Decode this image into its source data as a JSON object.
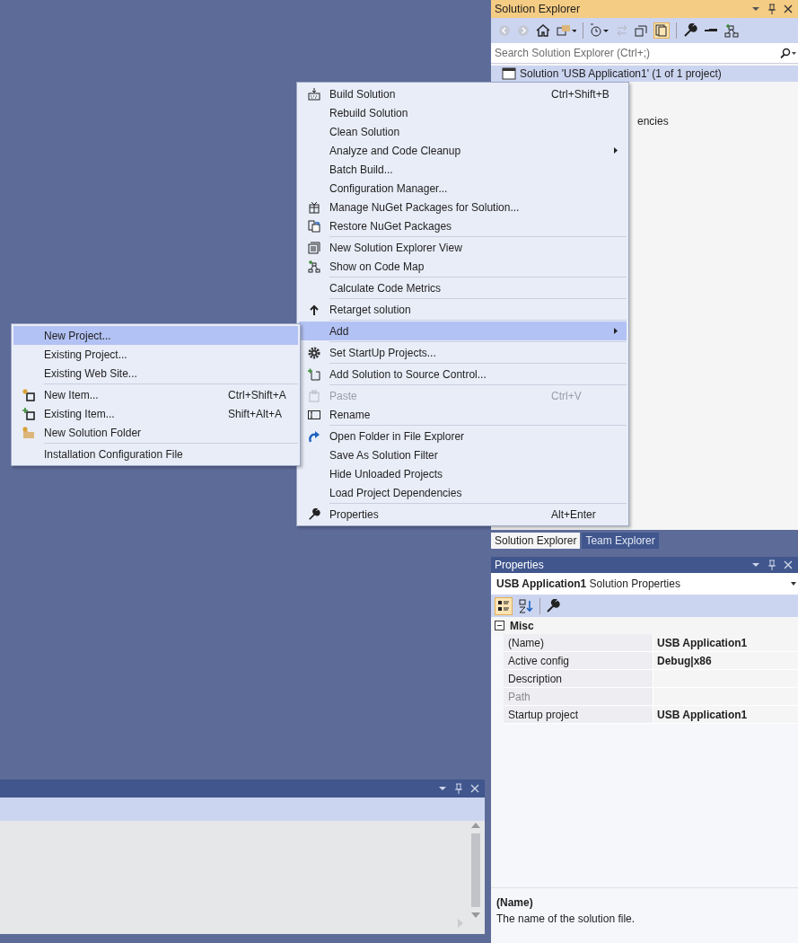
{
  "solution_explorer": {
    "title": "Solution Explorer",
    "search": {
      "placeholder": "Search Solution Explorer (Ctrl+;)"
    },
    "tree": [
      {
        "label": "Solution 'USB Application1' (1 of 1 project)",
        "selected": true
      },
      {
        "label": "encies",
        "selected": false
      }
    ]
  },
  "context_menu": {
    "groups": [
      [
        {
          "label": "Build Solution",
          "shortcut": "Ctrl+Shift+B",
          "submenu": false,
          "selected": false,
          "disabled": false
        },
        {
          "label": "Rebuild Solution",
          "submenu": false,
          "selected": false,
          "disabled": false
        },
        {
          "label": "Clean Solution",
          "submenu": false,
          "selected": false,
          "disabled": false
        },
        {
          "label": "Analyze and Code Cleanup",
          "submenu": true,
          "selected": false,
          "disabled": false
        },
        {
          "label": "Batch Build...",
          "submenu": false,
          "selected": false,
          "disabled": false
        },
        {
          "label": "Configuration Manager...",
          "submenu": false,
          "selected": false,
          "disabled": false
        },
        {
          "label": "Manage NuGet Packages for Solution...",
          "submenu": false,
          "selected": false,
          "disabled": false
        },
        {
          "label": "Restore NuGet Packages",
          "submenu": false,
          "selected": false,
          "disabled": false
        }
      ],
      [
        {
          "label": "New Solution Explorer View",
          "submenu": false,
          "selected": false,
          "disabled": false
        },
        {
          "label": "Show on Code Map",
          "submenu": false,
          "selected": false,
          "disabled": false
        }
      ],
      [
        {
          "label": "Calculate Code Metrics",
          "submenu": false,
          "selected": false,
          "disabled": false
        }
      ],
      [
        {
          "label": "Retarget solution",
          "submenu": false,
          "selected": false,
          "disabled": false
        }
      ],
      [
        {
          "label": "Add",
          "submenu": true,
          "selected": true,
          "disabled": false
        }
      ],
      [
        {
          "label": "Set StartUp Projects...",
          "submenu": false,
          "selected": false,
          "disabled": false
        }
      ],
      [
        {
          "label": "Add Solution to Source Control...",
          "submenu": false,
          "selected": false,
          "disabled": false
        }
      ],
      [
        {
          "label": "Paste",
          "shortcut": "Ctrl+V",
          "submenu": false,
          "selected": false,
          "disabled": true
        },
        {
          "label": "Rename",
          "submenu": false,
          "selected": false,
          "disabled": false
        }
      ],
      [
        {
          "label": "Open Folder in File Explorer",
          "submenu": false,
          "selected": false,
          "disabled": false
        },
        {
          "label": "Save As Solution Filter",
          "submenu": false,
          "selected": false,
          "disabled": false
        },
        {
          "label": "Hide Unloaded Projects",
          "submenu": false,
          "selected": false,
          "disabled": false
        },
        {
          "label": "Load Project Dependencies",
          "submenu": false,
          "selected": false,
          "disabled": false
        }
      ],
      [
        {
          "label": "Properties",
          "shortcut": "Alt+Enter",
          "submenu": false,
          "selected": false,
          "disabled": false
        }
      ]
    ]
  },
  "add_submenu": {
    "groups": [
      [
        {
          "label": "New Project...",
          "selected": true
        },
        {
          "label": "Existing Project...",
          "selected": false
        },
        {
          "label": "Existing Web Site...",
          "selected": false
        }
      ],
      [
        {
          "label": "New Item...",
          "shortcut": "Ctrl+Shift+A",
          "selected": false
        },
        {
          "label": "Existing Item...",
          "shortcut": "Shift+Alt+A",
          "selected": false
        },
        {
          "label": "New Solution Folder",
          "selected": false
        }
      ],
      [
        {
          "label": "Installation Configuration File",
          "selected": false
        }
      ]
    ]
  },
  "tabs": [
    {
      "label": "Solution Explorer",
      "selected": true
    },
    {
      "label": "Team Explorer",
      "selected": false
    }
  ],
  "properties": {
    "title": "Properties",
    "object": "**USB Application1**  Solution Properties",
    "category": "Misc",
    "expanded": true,
    "rows": [
      {
        "name": "(Name)",
        "value": "USB Application1",
        "disabled": false
      },
      {
        "name": "Active config",
        "value": "Debug|x86",
        "disabled": false
      },
      {
        "name": "Description",
        "disabled": false
      },
      {
        "name": "Path",
        "disabled": true
      },
      {
        "name": "Startup project",
        "value": "USB Application1",
        "disabled": false
      }
    ],
    "description": {
      "title": "(Name)",
      "text": "The name of the solution file."
    }
  }
}
